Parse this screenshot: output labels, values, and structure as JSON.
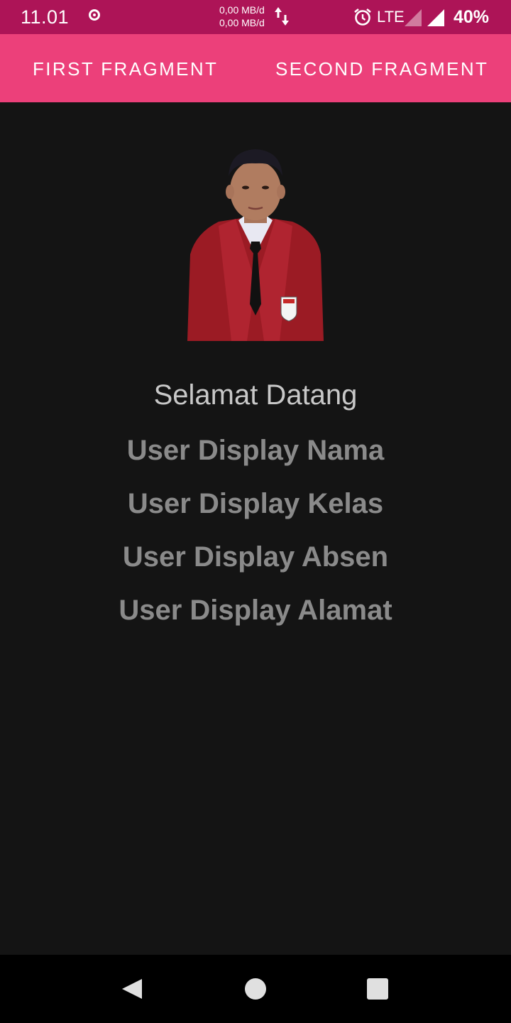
{
  "status_bar": {
    "time": "11.01",
    "net_up": "0,00 MB/d",
    "net_down": "0,00 MB/d",
    "network": "LTE",
    "battery": "40%",
    "icons": [
      "record-icon",
      "data-arrows-icon",
      "alarm-icon",
      "signal-icon",
      "signal-icon"
    ]
  },
  "tabs": [
    {
      "label": "FIRST FRAGMENT"
    },
    {
      "label": "SECOND FRAGMENT"
    }
  ],
  "main": {
    "greeting": "Selamat Datang",
    "nama": "User Display Nama",
    "kelas": "User Display Kelas",
    "absen": "User Display Absen",
    "alamat": "User Display Alamat"
  },
  "nav": {
    "icons": [
      "back-icon",
      "home-icon",
      "recents-icon"
    ]
  },
  "colors": {
    "status_bar": "#ad1457",
    "tab_bar": "#ec407a",
    "background": "#141414",
    "greeting_text": "#c8c8c8",
    "info_text": "#8a8a8a"
  }
}
